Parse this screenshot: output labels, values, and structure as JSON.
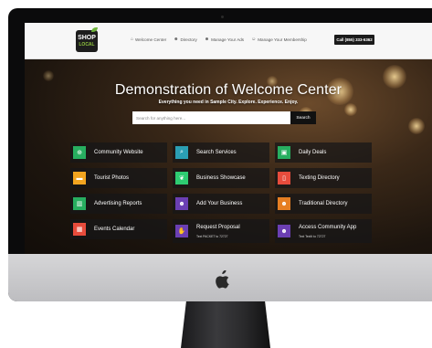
{
  "header": {
    "logo": {
      "top": "SHOP",
      "bottom": "LOCAL"
    },
    "nav": [
      {
        "icon": "home-icon",
        "glyph": "⌂",
        "label": "Welcome Center"
      },
      {
        "icon": "users-icon",
        "glyph": "☻",
        "label": "Directory"
      },
      {
        "icon": "group-icon",
        "glyph": "☻",
        "label": "Manage Your Ads"
      },
      {
        "icon": "user-icon",
        "glyph": "☺",
        "label": "Manage Your Membership"
      }
    ],
    "call_button": "Call (855) 333-6362"
  },
  "hero": {
    "title": "Demonstration of Welcome Center",
    "subtitle": "Everything you need in Sample City. Explore. Experience. Enjoy.",
    "search_placeholder": "Search for anything here...",
    "search_button": "Search"
  },
  "tiles": [
    {
      "label": "Community Website",
      "sub": "",
      "color": "#27ae60",
      "icon": "globe-icon",
      "glyph": "⊕"
    },
    {
      "label": "Search Services",
      "sub": "",
      "color": "#2b9eb3",
      "icon": "search-icon",
      "glyph": "⌕"
    },
    {
      "label": "Daily Deals",
      "sub": "",
      "color": "#27ae60",
      "icon": "money-icon",
      "glyph": "▣"
    },
    {
      "label": "Tourist Photos",
      "sub": "",
      "color": "#f2a41f",
      "icon": "photo-icon",
      "glyph": "▬"
    },
    {
      "label": "Business Showcase",
      "sub": "",
      "color": "#2ecc71",
      "icon": "leaf-icon",
      "glyph": "❦"
    },
    {
      "label": "Texting Directory",
      "sub": "",
      "color": "#e74c3c",
      "icon": "mobile-icon",
      "glyph": "▯"
    },
    {
      "label": "Advertising Reports",
      "sub": "",
      "color": "#27ae60",
      "icon": "chart-icon",
      "glyph": "▥"
    },
    {
      "label": "Add Your Business",
      "sub": "",
      "color": "#6b3fb3",
      "icon": "add-user-icon",
      "glyph": "☻"
    },
    {
      "label": "Traditional Directory",
      "sub": "",
      "color": "#e67e22",
      "icon": "group-icon",
      "glyph": "☻"
    },
    {
      "label": "Events Calendar",
      "sub": "",
      "color": "#e74c3c",
      "icon": "calendar-icon",
      "glyph": "▦"
    },
    {
      "label": "Request Proposal",
      "sub": "Text PACKET to 72727",
      "color": "#6b3fb3",
      "icon": "handshake-icon",
      "glyph": "✋"
    },
    {
      "label": "Access Community App",
      "sub": "Text TextIt to 72727",
      "color": "#6b3fb3",
      "icon": "community-icon",
      "glyph": "☻"
    }
  ]
}
